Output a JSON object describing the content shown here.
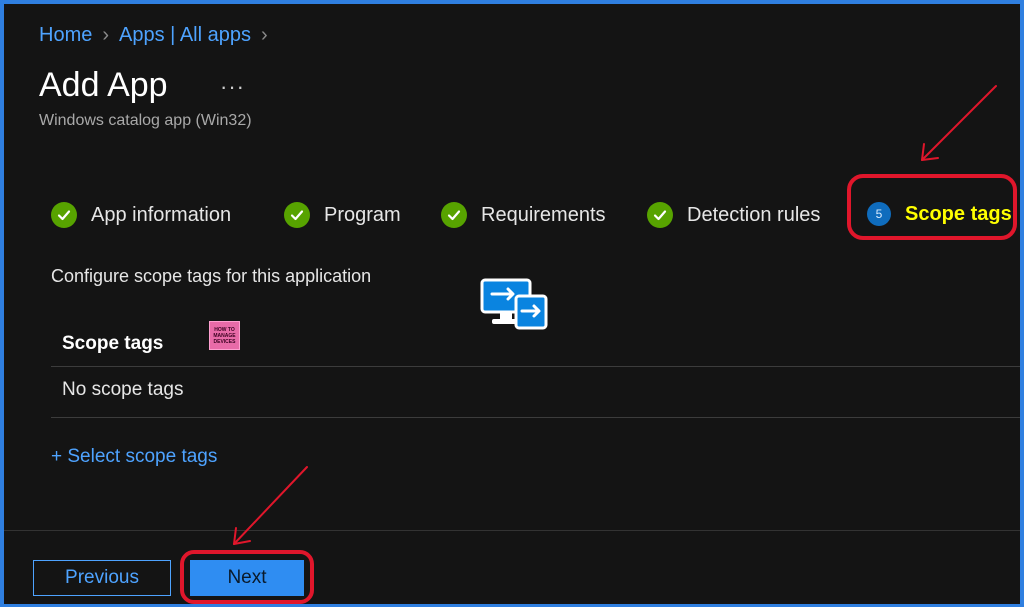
{
  "breadcrumb": {
    "home": "Home",
    "apps": "Apps | All apps"
  },
  "page": {
    "title": "Add App",
    "more": "···",
    "subtitle": "Windows catalog app (Win32)"
  },
  "steps": [
    {
      "label": "App information",
      "state": "done"
    },
    {
      "label": "Program",
      "state": "done"
    },
    {
      "label": "Requirements",
      "state": "done"
    },
    {
      "label": "Detection rules",
      "state": "done"
    },
    {
      "label": "Scope tags",
      "number": "5",
      "state": "active"
    }
  ],
  "content": {
    "description": "Configure scope tags for this application",
    "table_header": "Scope tags",
    "empty_row": "No scope tags",
    "select_link": "+ Select scope tags"
  },
  "badge": {
    "line1": "HOW TO",
    "line2": "MANAGE",
    "line3": "DEVICES"
  },
  "footer": {
    "previous": "Previous",
    "next": "Next"
  },
  "colors": {
    "accent": "#4ea3ff",
    "success": "#57a300",
    "annotation": "#e0162b",
    "highlight": "#ffff00",
    "background": "#141414"
  },
  "icons": {
    "check": "checkmark-circle-icon",
    "step": "step-number-circle-icon",
    "remote": "remote-desktop-icon",
    "chevron": "chevron-right-icon"
  }
}
